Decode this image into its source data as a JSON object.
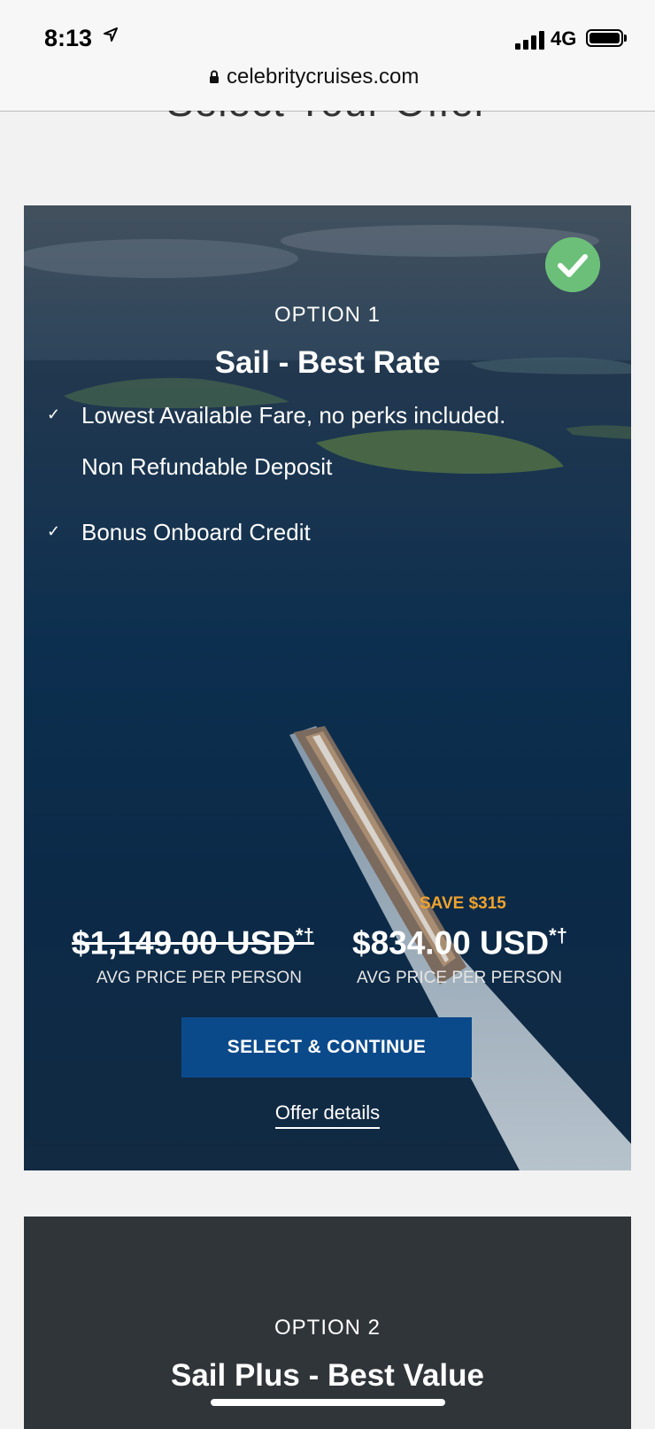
{
  "status_bar": {
    "time": "8:13",
    "network": "4G",
    "url": "celebritycruises.com"
  },
  "page": {
    "section_title": "Select Your Offer"
  },
  "offers": [
    {
      "option_label": "OPTION 1",
      "title": "Sail - Best Rate",
      "selected": true,
      "features": [
        {
          "text": "Lowest Available Fare, no perks included.",
          "checked": true
        },
        {
          "text": "Non Refundable Deposit",
          "checked": false
        },
        {
          "text": "Bonus Onboard Credit",
          "checked": true
        }
      ],
      "original_price": "$1,149.00 USD",
      "sale_price": "$834.00 USD",
      "price_marks": "*†",
      "savings": "SAVE $315",
      "original_price_caption": "AVG PRICE PER PERSON",
      "sale_price_caption": "AVG PRICE PER PERSON",
      "cta_label": "SELECT & CONTINUE",
      "details_link": "Offer details"
    },
    {
      "option_label": "OPTION 2",
      "title": "Sail Plus - Best Value"
    }
  ],
  "colors": {
    "cta_background": "#0b4a8a",
    "savings_text": "#f0a22d",
    "selected_badge": "#6cbf78"
  },
  "icons": [
    "location-arrow-icon",
    "signal-icon",
    "battery-icon",
    "lock-icon",
    "checkmark-badge-icon",
    "checkmark-icon"
  ]
}
